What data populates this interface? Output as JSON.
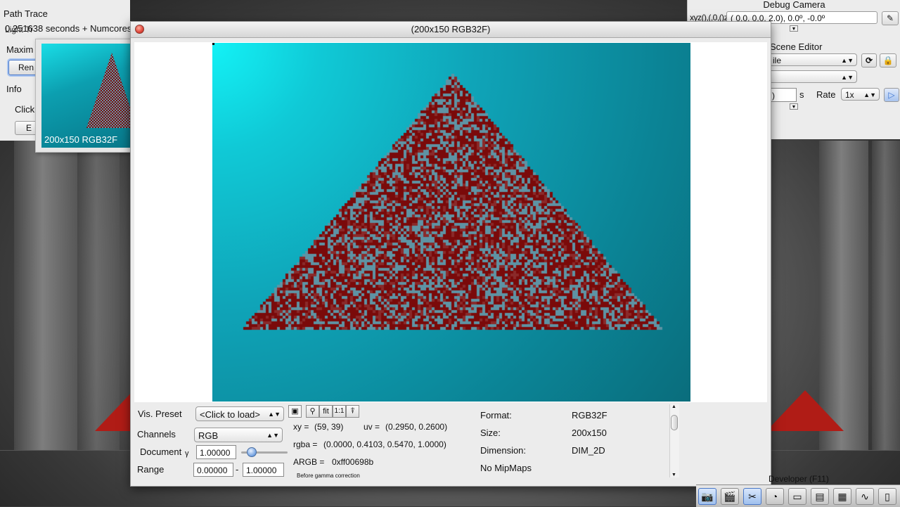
{
  "background_panel": {
    "title": "Path Trace",
    "status": "0.251638 seconds + Numcores",
    "overlap_label": "Light Tr",
    "maxim_label": "Maxim",
    "ren_button": "Ren",
    "info_label": "Info",
    "click_label": "Click",
    "e_button": "E"
  },
  "thumbnail": {
    "label": "200x150 RGB32F"
  },
  "debug_camera": {
    "title": "Debug Camera",
    "xyz_label": "xyz(),(,0,()z",
    "coords": "(  0.0,   0.0,   2.0),   0.0º,  -0.0º",
    "scene_editor": "Scene Editor",
    "scene_value": "ile",
    "s_label": "s",
    "rate_label": "Rate",
    "rate_value": "1x",
    "time_value": ")"
  },
  "viewer": {
    "title": "(200x150 RGB32F)",
    "vis_preset_label": "Vis. Preset",
    "vis_preset_value": "<Click to load>",
    "channels_label": "Channels",
    "channels_value": "RGB",
    "document_label": "Document",
    "gamma_symbol": "γ",
    "gamma_value": "1.00000",
    "gamma_slider": 0.15,
    "range_label": "Range",
    "range_min": "0.00000",
    "range_sep": "-",
    "range_max": "1.00000",
    "tool_fit": "fit",
    "tool_1to1": "1:1",
    "xy_label": "xy =",
    "xy_value": "(59, 39)",
    "uv_label": "uv =",
    "uv_value": "(0.2950, 0.2600)",
    "rgba_label": "rgba =",
    "rgba_value": "(0.0000, 0.4103, 0.5470, 1.0000)",
    "argb_label": "ARGB =",
    "argb_value": "0xff00698b",
    "gamma_note": "Before gamma correction",
    "format_label": "Format:",
    "format_value": "RGB32F",
    "size_label": "Size:",
    "size_value": "200x150",
    "dimension_label": "Dimension:",
    "dimension_value": "DIM_2D",
    "mipmaps": "No MipMaps"
  },
  "dock": {
    "label": "Developer (F11)",
    "icons": [
      "camera-icon",
      "film-icon",
      "tools-icon",
      "clock-icon",
      "note-icon",
      "terminal-icon",
      "scene-icon",
      "graph-icon",
      "page-icon"
    ]
  },
  "colors": {
    "pyramid_red": "#7a0a0a",
    "pyramid_blue": "#5e93a4",
    "accent_red": "#c8201a"
  }
}
